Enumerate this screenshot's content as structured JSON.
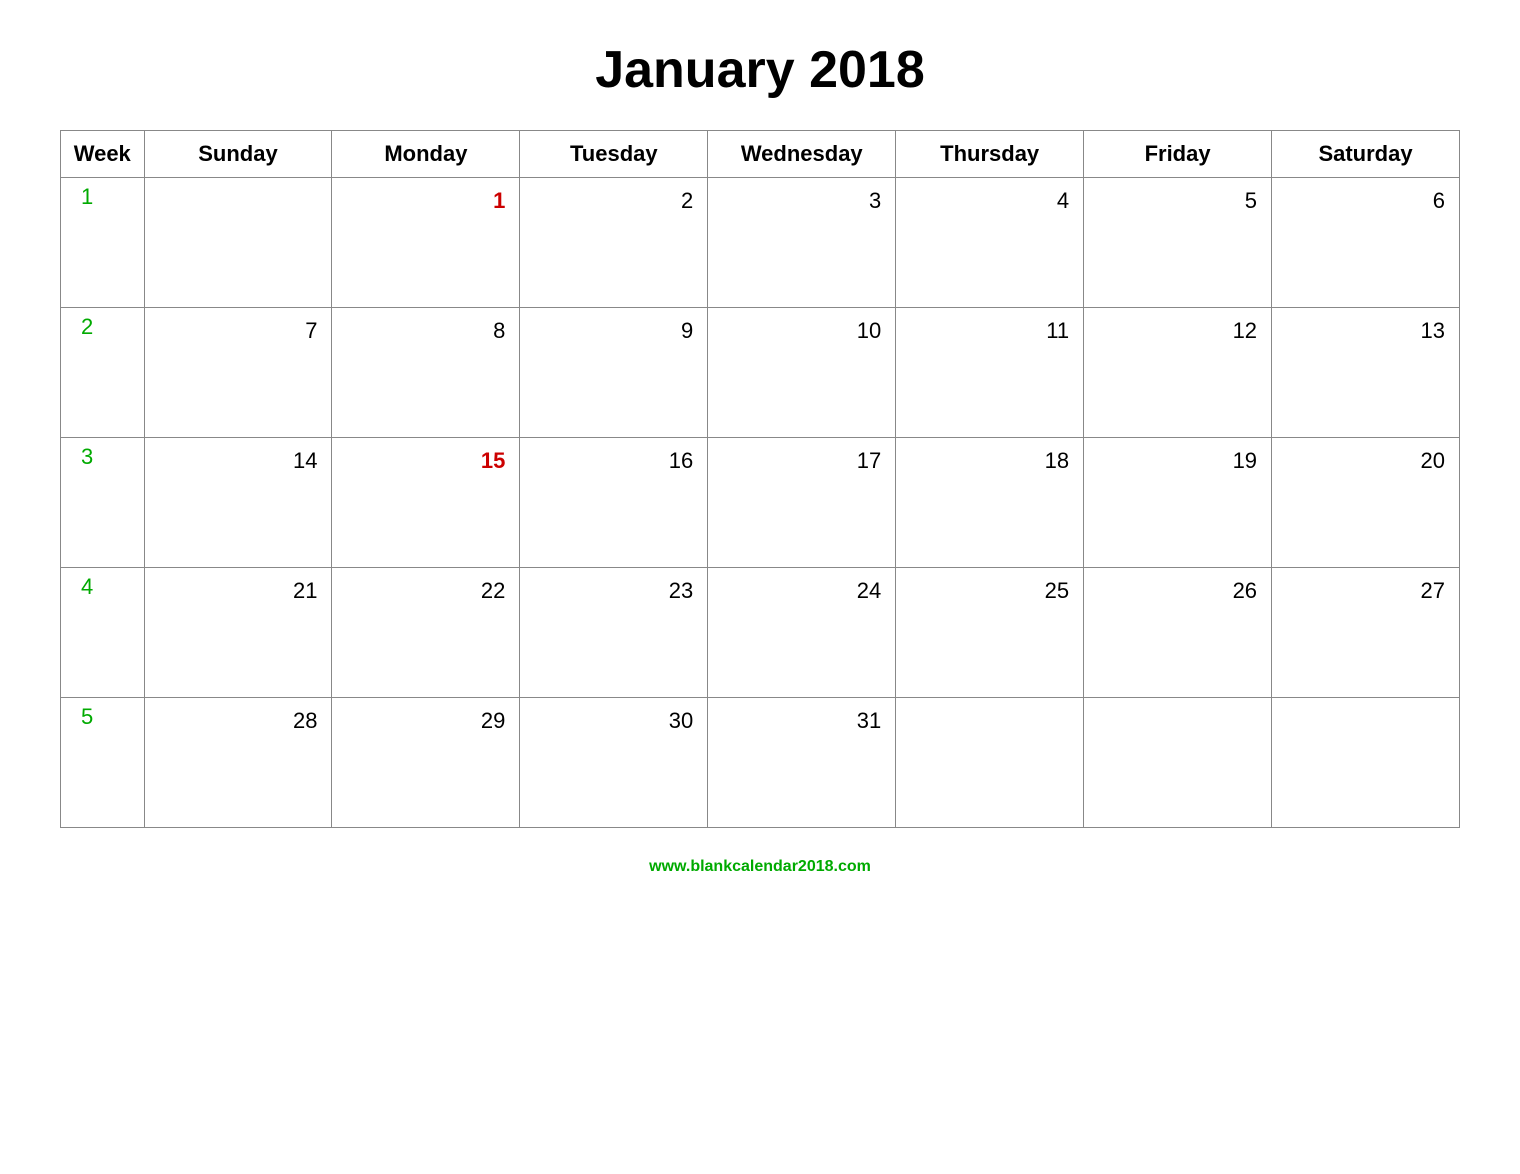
{
  "title": "January 2018",
  "footer": "www.blankcalendar2018.com",
  "headers": [
    "Week",
    "Sunday",
    "Monday",
    "Tuesday",
    "Wednesday",
    "Thursday",
    "Friday",
    "Saturday"
  ],
  "weeks": [
    {
      "week_number": "1",
      "days": [
        {
          "day": "",
          "type": "empty"
        },
        {
          "day": "1",
          "type": "holiday"
        },
        {
          "day": "2",
          "type": "normal"
        },
        {
          "day": "3",
          "type": "normal"
        },
        {
          "day": "4",
          "type": "normal"
        },
        {
          "day": "5",
          "type": "normal"
        },
        {
          "day": "6",
          "type": "normal"
        }
      ]
    },
    {
      "week_number": "2",
      "days": [
        {
          "day": "7",
          "type": "normal"
        },
        {
          "day": "8",
          "type": "normal"
        },
        {
          "day": "9",
          "type": "normal"
        },
        {
          "day": "10",
          "type": "normal"
        },
        {
          "day": "11",
          "type": "normal"
        },
        {
          "day": "12",
          "type": "normal"
        },
        {
          "day": "13",
          "type": "normal"
        }
      ]
    },
    {
      "week_number": "3",
      "days": [
        {
          "day": "14",
          "type": "normal"
        },
        {
          "day": "15",
          "type": "holiday"
        },
        {
          "day": "16",
          "type": "normal"
        },
        {
          "day": "17",
          "type": "normal"
        },
        {
          "day": "18",
          "type": "normal"
        },
        {
          "day": "19",
          "type": "normal"
        },
        {
          "day": "20",
          "type": "normal"
        }
      ]
    },
    {
      "week_number": "4",
      "days": [
        {
          "day": "21",
          "type": "normal"
        },
        {
          "day": "22",
          "type": "normal"
        },
        {
          "day": "23",
          "type": "normal"
        },
        {
          "day": "24",
          "type": "normal"
        },
        {
          "day": "25",
          "type": "normal"
        },
        {
          "day": "26",
          "type": "normal"
        },
        {
          "day": "27",
          "type": "normal"
        }
      ]
    },
    {
      "week_number": "5",
      "days": [
        {
          "day": "28",
          "type": "normal"
        },
        {
          "day": "29",
          "type": "normal"
        },
        {
          "day": "30",
          "type": "normal"
        },
        {
          "day": "31",
          "type": "normal"
        },
        {
          "day": "",
          "type": "empty"
        },
        {
          "day": "",
          "type": "empty"
        },
        {
          "day": "",
          "type": "empty"
        }
      ]
    }
  ]
}
